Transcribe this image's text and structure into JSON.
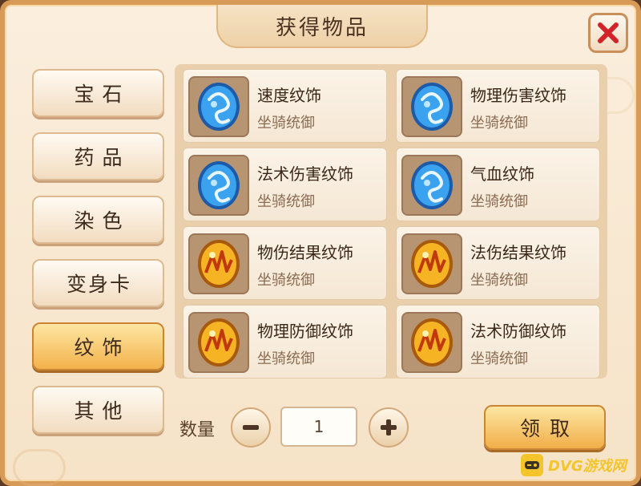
{
  "window": {
    "title": "获得物品",
    "close_icon": "close-x-icon"
  },
  "categories": [
    {
      "label": "宝石",
      "active": false
    },
    {
      "label": "药品",
      "active": false
    },
    {
      "label": "染色",
      "active": false
    },
    {
      "label": "变身卡",
      "active": false
    },
    {
      "label": "纹饰",
      "active": true
    },
    {
      "label": "其他",
      "active": false
    }
  ],
  "items": [
    {
      "name": "速度纹饰",
      "desc": "坐骑统御",
      "icon": "blue-crest-icon"
    },
    {
      "name": "物理伤害纹饰",
      "desc": "坐骑统御",
      "icon": "blue-crest-icon"
    },
    {
      "name": "法术伤害纹饰",
      "desc": "坐骑统御",
      "icon": "blue-crest-icon"
    },
    {
      "name": "气血纹饰",
      "desc": "坐骑统御",
      "icon": "blue-crest-icon"
    },
    {
      "name": "物伤结果纹饰",
      "desc": "坐骑统御",
      "icon": "gold-crest-icon"
    },
    {
      "name": "法伤结果纹饰",
      "desc": "坐骑统御",
      "icon": "gold-crest-icon"
    },
    {
      "name": "物理防御纹饰",
      "desc": "坐骑统御",
      "icon": "gold-crest-icon"
    },
    {
      "name": "法术防御纹饰",
      "desc": "坐骑统御",
      "icon": "gold-crest-icon"
    }
  ],
  "quantity": {
    "label": "数量",
    "value": "1",
    "minus_icon": "minus-icon",
    "plus_icon": "plus-icon"
  },
  "claim_label": "领取",
  "watermark": {
    "text": "DVG游戏网"
  },
  "colors": {
    "active_button": "#f3b24c",
    "blue_crest": "#2f8fe0",
    "gold_crest": "#f0a21c",
    "close_x": "#d2232a"
  }
}
